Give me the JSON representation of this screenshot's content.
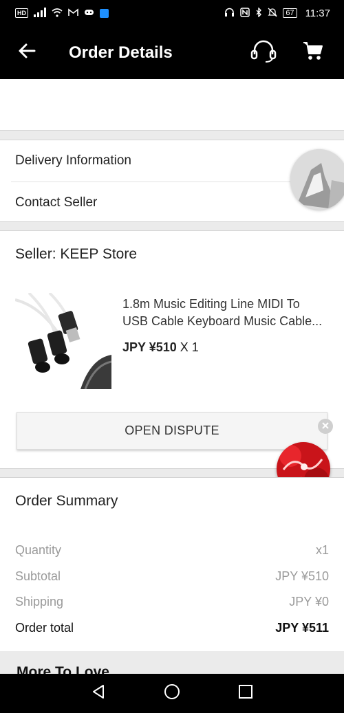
{
  "status_bar": {
    "left_badge": "HD",
    "icons": [
      "signal-icon",
      "wifi-icon",
      "gmail-icon",
      "discord-icon",
      "shield-app-icon"
    ],
    "right_icons": [
      "headphones-icon",
      "nfc-icon",
      "bluetooth-icon",
      "mute-icon"
    ],
    "battery": "67",
    "time": "11:37"
  },
  "app_bar": {
    "title": "Order Details",
    "actions": [
      "headset-support-icon",
      "cart-icon"
    ]
  },
  "links": {
    "delivery": "Delivery Information",
    "contact": "Contact Seller"
  },
  "seller": {
    "name": "Seller: KEEP Store"
  },
  "product": {
    "title_line1": "1.8m Music Editing Line MIDI To",
    "title_line2": "USB Cable Keyboard Music Cable...",
    "price": "JPY ¥510",
    "quantity": "X 1"
  },
  "dispute": {
    "label": "OPEN DISPUTE"
  },
  "summary": {
    "title": "Order Summary",
    "rows": [
      {
        "label": "Quantity",
        "value": "x1"
      },
      {
        "label": "Subtotal",
        "value": "JPY ¥510"
      },
      {
        "label": "Shipping",
        "value": "JPY ¥0"
      },
      {
        "label": "Order total",
        "value": "JPY ¥511"
      }
    ]
  },
  "more": {
    "label": "More To Love"
  },
  "colors": {
    "bar_background": "#000000",
    "page_background": "#ebebeb",
    "card_background": "#ffffff",
    "muted_text": "#9a9a9a"
  }
}
